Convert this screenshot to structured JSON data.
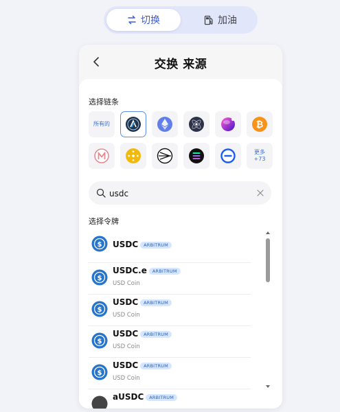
{
  "tabs": [
    {
      "label": "切换",
      "icon": "swap-arrows-icon",
      "active": true
    },
    {
      "label": "加油",
      "icon": "fuel-pump-icon",
      "active": false
    }
  ],
  "panel": {
    "title": "交换 来源"
  },
  "chains": {
    "label": "选择链条",
    "items": [
      {
        "type": "text",
        "label": "所有的",
        "selected": false
      },
      {
        "icon": "arbitrum-icon",
        "selected": true
      },
      {
        "icon": "ethereum-icon",
        "selected": false
      },
      {
        "icon": "cosmos-icon",
        "selected": false
      },
      {
        "icon": "purple-sphere-icon",
        "selected": false
      },
      {
        "icon": "bitcoin-icon",
        "selected": false
      },
      {
        "icon": "maker-m-icon",
        "selected": false
      },
      {
        "icon": "bnb-icon",
        "selected": false
      },
      {
        "icon": "near-style-icon",
        "selected": false
      },
      {
        "icon": "solana-icon",
        "selected": false
      },
      {
        "icon": "blue-ring-icon",
        "selected": false
      },
      {
        "type": "more",
        "label": "更多",
        "count": "+73",
        "selected": false
      }
    ]
  },
  "search": {
    "value": "usdc",
    "icon": "search-icon"
  },
  "tokens": {
    "label": "选择令牌",
    "items": [
      {
        "symbol": "USDC",
        "chain": "ARBITRUM",
        "name": ""
      },
      {
        "symbol": "USDC.e",
        "chain": "ARBITRUM",
        "name": "USD Coin"
      },
      {
        "symbol": "USDC",
        "chain": "ARBITRUM",
        "name": "USD Coin"
      },
      {
        "symbol": "USDC",
        "chain": "ARBITRUM",
        "name": "USD Coin"
      },
      {
        "symbol": "USDC",
        "chain": "ARBITRUM",
        "name": "USD Coin"
      },
      {
        "symbol": "aUSDC",
        "chain": "ARBITRUM",
        "name": ""
      }
    ]
  },
  "colors": {
    "accent": "#3b5bdb",
    "usdc": "#2775ca",
    "badge_bg": "#d5e6ff"
  }
}
